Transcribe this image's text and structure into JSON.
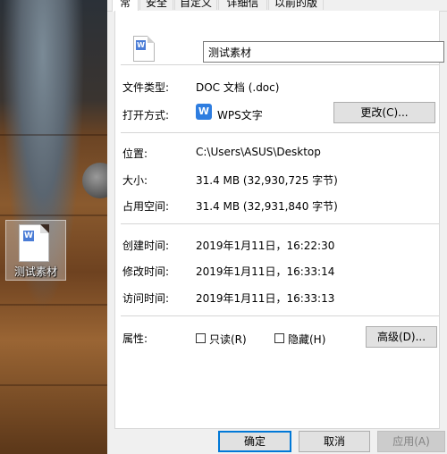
{
  "desktop": {
    "icon_label": "测试素材",
    "icon_badge": "W"
  },
  "tabs": [
    "常规",
    "安全",
    "自定义",
    "详细信息",
    "以前的版本"
  ],
  "general": {
    "file_name": "测试素材",
    "file_badge": "W",
    "file_type_label": "文件类型:",
    "file_type_value": "DOC 文档 (.doc)",
    "open_with_label": "打开方式:",
    "open_with_app": "WPS文字",
    "open_with_badge": "W",
    "change_button": "更改(C)...",
    "location_label": "位置:",
    "location_value": "C:\\Users\\ASUS\\Desktop",
    "size_label": "大小:",
    "size_value": "31.4 MB (32,930,725 字节)",
    "size_on_disk_label": "占用空间:",
    "size_on_disk_value": "31.4 MB (32,931,840 字节)",
    "created_label": "创建时间:",
    "created_value": "2019年1月11日，16:22:30",
    "modified_label": "修改时间:",
    "modified_value": "2019年1月11日，16:33:14",
    "accessed_label": "访问时间:",
    "accessed_value": "2019年1月11日，16:33:13",
    "attributes_label": "属性:",
    "readonly_label": "只读(R)",
    "hidden_label": "隐藏(H)",
    "advanced_button": "高级(D)..."
  },
  "footer": {
    "ok": "确定",
    "cancel": "取消",
    "apply": "应用(A)"
  },
  "colors": {
    "accent": "#0078d7",
    "wps_blue": "#2e7de0"
  }
}
